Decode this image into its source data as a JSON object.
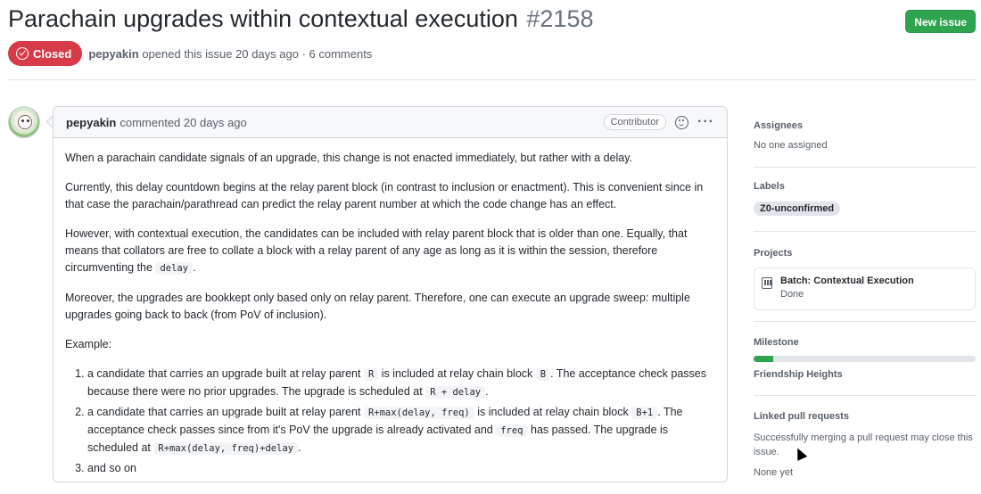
{
  "issue": {
    "title": "Parachain upgrades within contextual execution",
    "number": "#2158",
    "state": "Closed",
    "author": "pepyakin",
    "opened_text": "opened this issue 20 days ago · 6 comments"
  },
  "header": {
    "new_issue_label": "New issue"
  },
  "comment": {
    "author": "pepyakin",
    "time_text": "commented 20 days ago",
    "role": "Contributor",
    "p1": "When a parachain candidate signals of an upgrade, this change is not enacted immediately, but rather with a delay.",
    "p2": "Currently, this delay countdown begins at the relay parent block (in contrast to inclusion or enactment). This is convenient since in that case the parachain/parathread can predict the relay parent number at which the code change has an effect.",
    "p3_a": "However, with contextual execution, the candidates can be included with relay parent block that is older than one. Equally, that means that collators are free to collate a block with a relay parent of any age as long as it is within the session, therefore circumventing the",
    "p3_code": "delay",
    "p3_b": ".",
    "p4": "Moreover, the upgrades are bookkept only based only on relay parent. Therefore, one can execute an upgrade sweep: multiple upgrades going back to back (from PoV of inclusion).",
    "p5": "Example:",
    "li1_a": "a candidate that carries an upgrade built at relay parent",
    "li1_c1": "R",
    "li1_b": "is included at relay chain block",
    "li1_c2": "B",
    "li1_c": ". The acceptance check passes because there were no prior upgrades. The upgrade is scheduled at",
    "li1_c3": "R + delay",
    "li1_d": ".",
    "li2_a": "a candidate that carries an upgrade built at relay parent",
    "li2_c1": "R+max(delay, freq)",
    "li2_b": "is included at relay chain block",
    "li2_c2": "B+1",
    "li2_c": ". The acceptance check passes since from it's PoV the upgrade is already activated and",
    "li2_c3": "freq",
    "li2_d": "has passed. The upgrade is scheduled at",
    "li2_c4": "R+max(delay, freq)+delay",
    "li2_e": ".",
    "li3": "and so on"
  },
  "sidebar": {
    "assignees_title": "Assignees",
    "assignees_value": "No one assigned",
    "labels_title": "Labels",
    "label": "Z0-unconfirmed",
    "projects_title": "Projects",
    "project_name": "Batch: Contextual Execution",
    "project_status": "Done",
    "milestone_title": "Milestone",
    "milestone_progress": 0.09,
    "milestone_name": "Friendship Heights",
    "linked_title": "Linked pull requests",
    "linked_text": "Successfully merging a pull request may close this issue.",
    "linked_none": "None yet"
  },
  "colors": {
    "closed": "#d73a49",
    "new_issue": "#2ea44f",
    "progress": "#2ea44f"
  }
}
